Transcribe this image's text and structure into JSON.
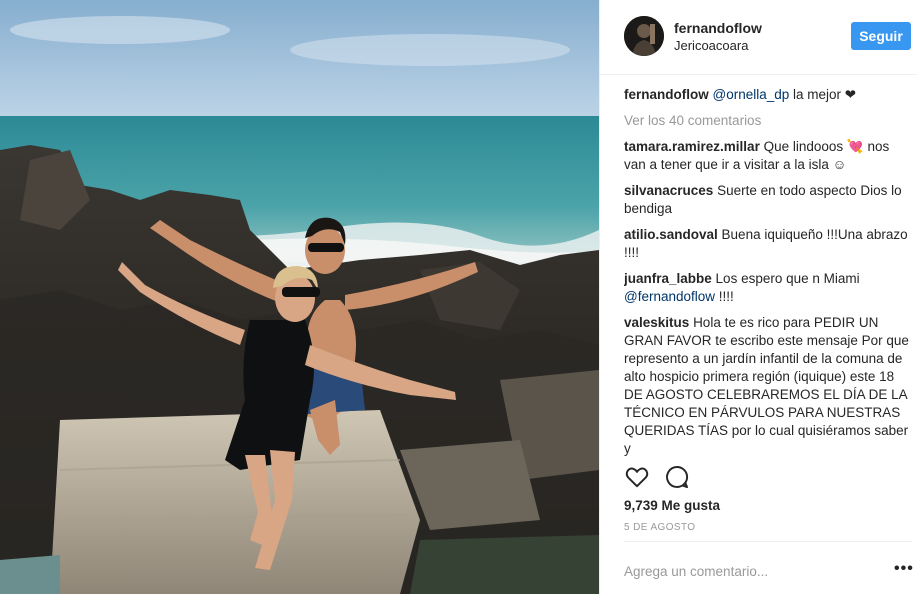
{
  "post": {
    "username": "fernandoflow",
    "location": "Jericoacoara",
    "follow_label": "Seguir"
  },
  "caption": {
    "username": "fernandoflow",
    "mention": "@ornella_dp",
    "text": " la mejor ❤"
  },
  "view_all_label": "Ver los 40 comentarios",
  "comments": [
    {
      "username": "tamara.ramirez.millar",
      "text": "Que lindooos 💘 nos van a tener que ir a visitar a la isla ☺"
    },
    {
      "username": "silvanacruces",
      "text": "Suerte en todo aspecto Dios lo bendiga"
    },
    {
      "username": "atilio.sandoval",
      "text": "Buena iquiqueño !!!Una abrazo !!!!"
    },
    {
      "username": "juanfra_labbe",
      "text": "Los espero que n Miami ",
      "mention": "@fernandoflow",
      "tail": " !!!!"
    },
    {
      "username": "valeskitus",
      "text": "Hola te es rico para PEDIR UN GRAN FAVOR te escribo este mensaje Por que represento a un jardín infantil de la comuna de alto hospicio primera región (iquique) este 18 DE AGOSTO CELEBRAREMOS EL DÍA DE LA TÉCNICO EN PÁRVULOS PARA NUESTRAS QUERIDAS TÍAS por lo cual quisiéramos saber y"
    }
  ],
  "likes": "9,739 Me gusta",
  "date": "5 DE AGOSTO",
  "add_comment_placeholder": "Agrega un comentario...",
  "more_label": "•••",
  "icons": {
    "like": "heart-outline-icon",
    "comment": "speech-bubble-icon",
    "more": "ellipsis-icon"
  },
  "colors": {
    "follow_button": "#3897f0",
    "mention": "#003569",
    "muted": "#999999"
  }
}
